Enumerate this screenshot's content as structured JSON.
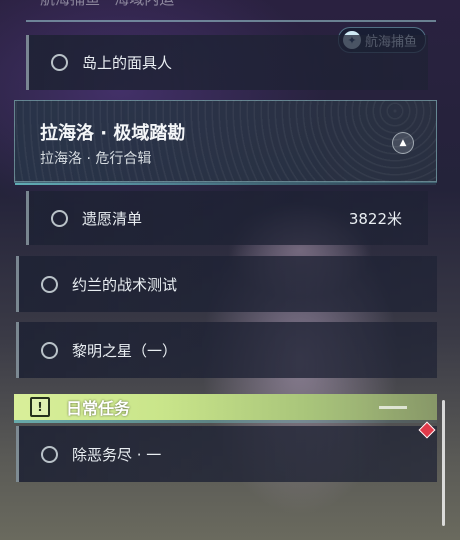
{
  "top_section": {
    "clipped_text": "航海捕鱼 · 海域内运"
  },
  "badge": {
    "icon": "fish-compass-icon",
    "label": "航海捕鱼"
  },
  "quests": [
    {
      "label": "岛上的面具人"
    }
  ],
  "chapter": {
    "title": "拉海洛 · 极域踏勘",
    "subtitle": "拉海洛 · 危行合辑",
    "collapse_icon": "triangle-up-icon"
  },
  "chapter_quests": [
    {
      "label": "遗愿清单",
      "distance": "3822米"
    },
    {
      "label": "约兰的战术测试"
    },
    {
      "label": "黎明之星（一）"
    }
  ],
  "daily": {
    "icon": "exclamation-box-icon",
    "title": "日常任务",
    "quests": [
      {
        "label": "除恶务尽 · 一"
      }
    ]
  },
  "colors": {
    "accent_teal": "#78e6e6",
    "daily_green": "#c9e58a",
    "alert_red": "#e03a4a"
  }
}
